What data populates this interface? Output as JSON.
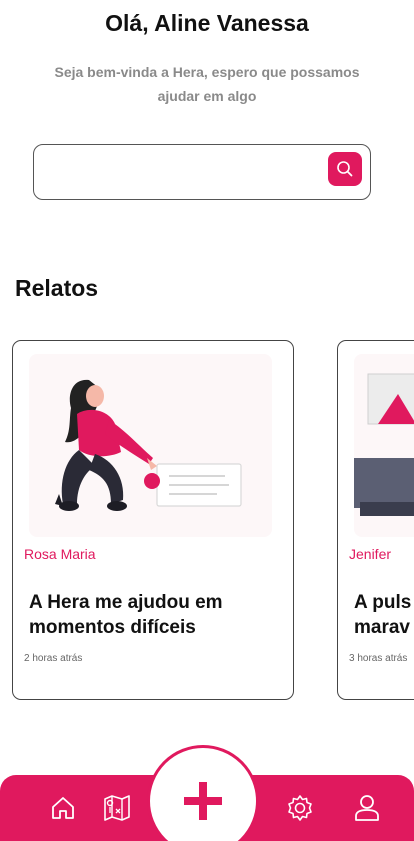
{
  "header": {
    "greeting": "Olá, Aline Vanessa",
    "subtitle": "Seja bem-vinda a Hera, espero que possamos ajudar em algo"
  },
  "search": {
    "value": "",
    "placeholder": "",
    "icon": "search-icon"
  },
  "section": {
    "title": "Relatos"
  },
  "reports": [
    {
      "author": "Rosa Maria",
      "title_line1": "A Hera me ajudou em",
      "title_line2": "momentos difíceis",
      "time": "2 horas atrás"
    },
    {
      "author": "Jenifer",
      "title_line1": "A puls",
      "title_line2": "marav",
      "time": "3 horas atrás"
    }
  ],
  "nav": {
    "items": [
      "home-icon",
      "map-icon",
      "add-icon",
      "settings-icon",
      "user-icon"
    ]
  },
  "colors": {
    "accent": "#e0195e",
    "subtitle": "#8a8a8a",
    "card_bg": "#fdf7f8"
  }
}
